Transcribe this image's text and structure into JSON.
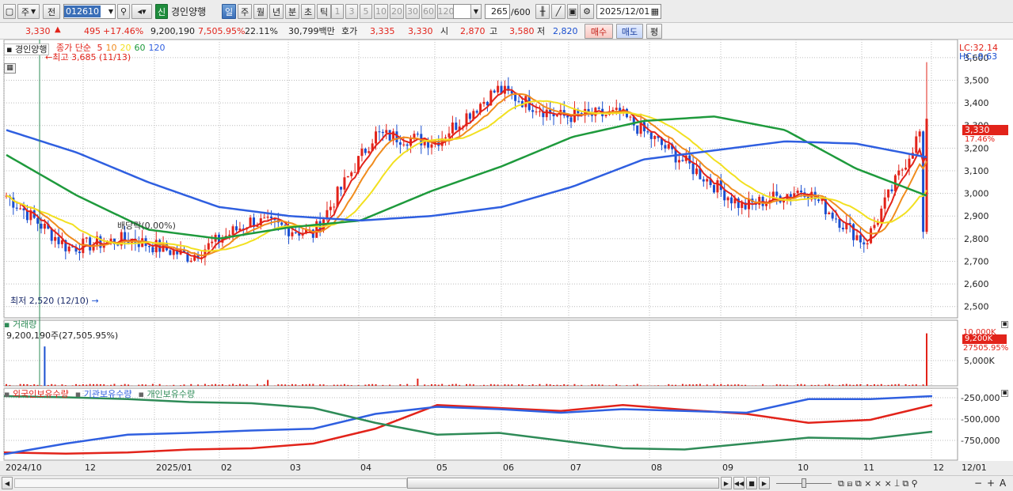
{
  "toolbar": {
    "mode_main": "주",
    "mode_prev": "전",
    "code": "012610",
    "new_badge": "신",
    "stock_name": "경인양행",
    "periods": [
      "일",
      "주",
      "월",
      "년",
      "분",
      "초",
      "틱"
    ],
    "numbers": [
      "1",
      "3",
      "5",
      "10",
      "20",
      "30",
      "60",
      "120"
    ],
    "count": "265",
    "count_total": "/600",
    "date": "2025/12/01"
  },
  "quote": {
    "price": "3,330",
    "change": "495",
    "change_pct": "+17.46%",
    "volume": "9,200,190",
    "volume_ratio": "7,505.95%",
    "turnover": "22.11%",
    "amount": "30,799백만",
    "bid_label": "호가",
    "bid": "3,335",
    "ask": "3,330",
    "open_label": "시",
    "open": "2,870",
    "high_label": "고",
    "high": "3,580",
    "low_label": "저",
    "low": "2,820",
    "buy": "매수",
    "sell": "매도",
    "flat": "평"
  },
  "price_panel": {
    "title": "경인양행",
    "ma_label": "종가 단순",
    "ma": [
      {
        "period": "5",
        "color": "#e2231a"
      },
      {
        "period": "10",
        "color": "#f08c1e"
      },
      {
        "period": "20",
        "color": "#f2e020"
      },
      {
        "period": "60",
        "color": "#1e9a3c"
      },
      {
        "period": "120",
        "color": "#2f5fe0"
      }
    ],
    "high_note": "최고 3,685 (11/13)",
    "low_note": "최저 2,520 (12/10)",
    "dividend_note": "배당락(0.00%)",
    "lc": "LC:32.14",
    "hc": "HC:-9.63",
    "price_tag": "3,330",
    "pct_tag": "17.46%",
    "yticks": [
      "3,600",
      "3,500",
      "3,400",
      "3,300",
      "3,200",
      "3,100",
      "3,000",
      "2,900",
      "2,800",
      "2,700",
      "2,600",
      "2,500"
    ],
    "ymin": 2450,
    "ymax": 3680
  },
  "volume_panel": {
    "title": "거래량",
    "value": "9,200,190주(27,505.95%)",
    "ytick": "5,000K",
    "ytick_top": "10,000K",
    "tag": "9,200K",
    "tag2": "27505.95%"
  },
  "holding_panel": {
    "series": [
      {
        "name": "외국인보유수량",
        "color": "#e2231a"
      },
      {
        "name": "기관보유수량",
        "color": "#2f5fe0"
      },
      {
        "name": "개인보유수량",
        "color": "#2e8b57"
      }
    ],
    "yticks": [
      "-250,000",
      "-500,000",
      "-750,000"
    ]
  },
  "x_axis": [
    "2024/10",
    "12",
    "2025/01",
    "02",
    "03",
    "04",
    "05",
    "06",
    "07",
    "08",
    "09",
    "10",
    "11",
    "12",
    "12/01"
  ],
  "chart_data": {
    "type": "line",
    "x_months": [
      "2024/10",
      "12",
      "2025/01",
      "02",
      "03",
      "04",
      "05",
      "06",
      "07",
      "08",
      "09",
      "10",
      "11",
      "12"
    ],
    "close_approx": [
      2990,
      2760,
      2800,
      2720,
      2880,
      2820,
      3260,
      3230,
      3460,
      3340,
      3350,
      3150,
      2940,
      3020,
      2780,
      3330
    ],
    "ma60_approx": [
      3170,
      2990,
      2840,
      2800,
      2850,
      2880,
      3010,
      3120,
      3250,
      3320,
      3340,
      3280,
      3110,
      2990
    ],
    "ma120_approx": [
      3280,
      3180,
      3050,
      2940,
      2900,
      2880,
      2900,
      2940,
      3030,
      3150,
      3190,
      3230,
      3220,
      3160
    ]
  },
  "bottom": {
    "zoom_minus": "−",
    "zoom_plus": "+",
    "font_a": "A"
  }
}
